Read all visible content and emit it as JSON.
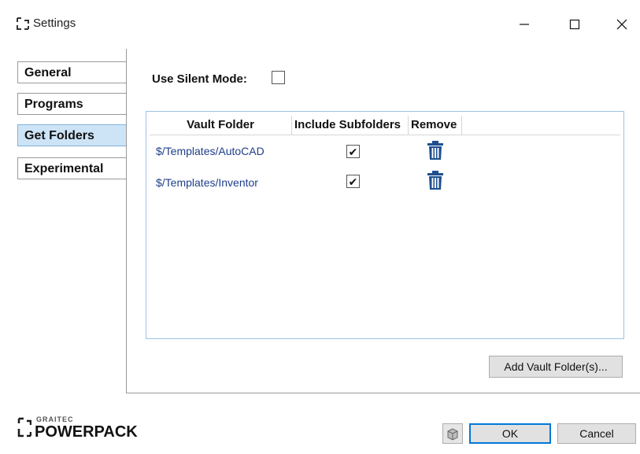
{
  "window": {
    "title": "Settings",
    "icons": {
      "app": "bracket-logo-icon",
      "minimize": "minimize-icon",
      "maximize": "maximize-icon",
      "close": "close-icon"
    }
  },
  "tabs": [
    {
      "label": "General",
      "selected": false
    },
    {
      "label": "Programs",
      "selected": false
    },
    {
      "label": "Get Folders",
      "selected": true
    },
    {
      "label": "Experimental",
      "selected": false
    }
  ],
  "silent_mode": {
    "label": "Use Silent Mode:",
    "checked": false
  },
  "grid": {
    "columns": [
      "Vault Folder",
      "Include Subfolders",
      "Remove"
    ],
    "rows": [
      {
        "path": "$/Templates/AutoCAD",
        "include_subfolders": true,
        "remove_icon": "trash-icon"
      },
      {
        "path": "$/Templates/Inventor",
        "include_subfolders": true,
        "remove_icon": "trash-icon"
      }
    ]
  },
  "add_button": {
    "label": "Add Vault Folder(s)..."
  },
  "footer": {
    "logo_small": "GRAITEC",
    "logo_big": "POWERPACK",
    "icon_button": "package-icon",
    "ok_label": "OK",
    "cancel_label": "Cancel"
  },
  "colors": {
    "selected_tab": "#cde4f7",
    "link_text": "#1f3e8a",
    "trash": "#1f4e8f",
    "ok_border": "#0078d7"
  }
}
